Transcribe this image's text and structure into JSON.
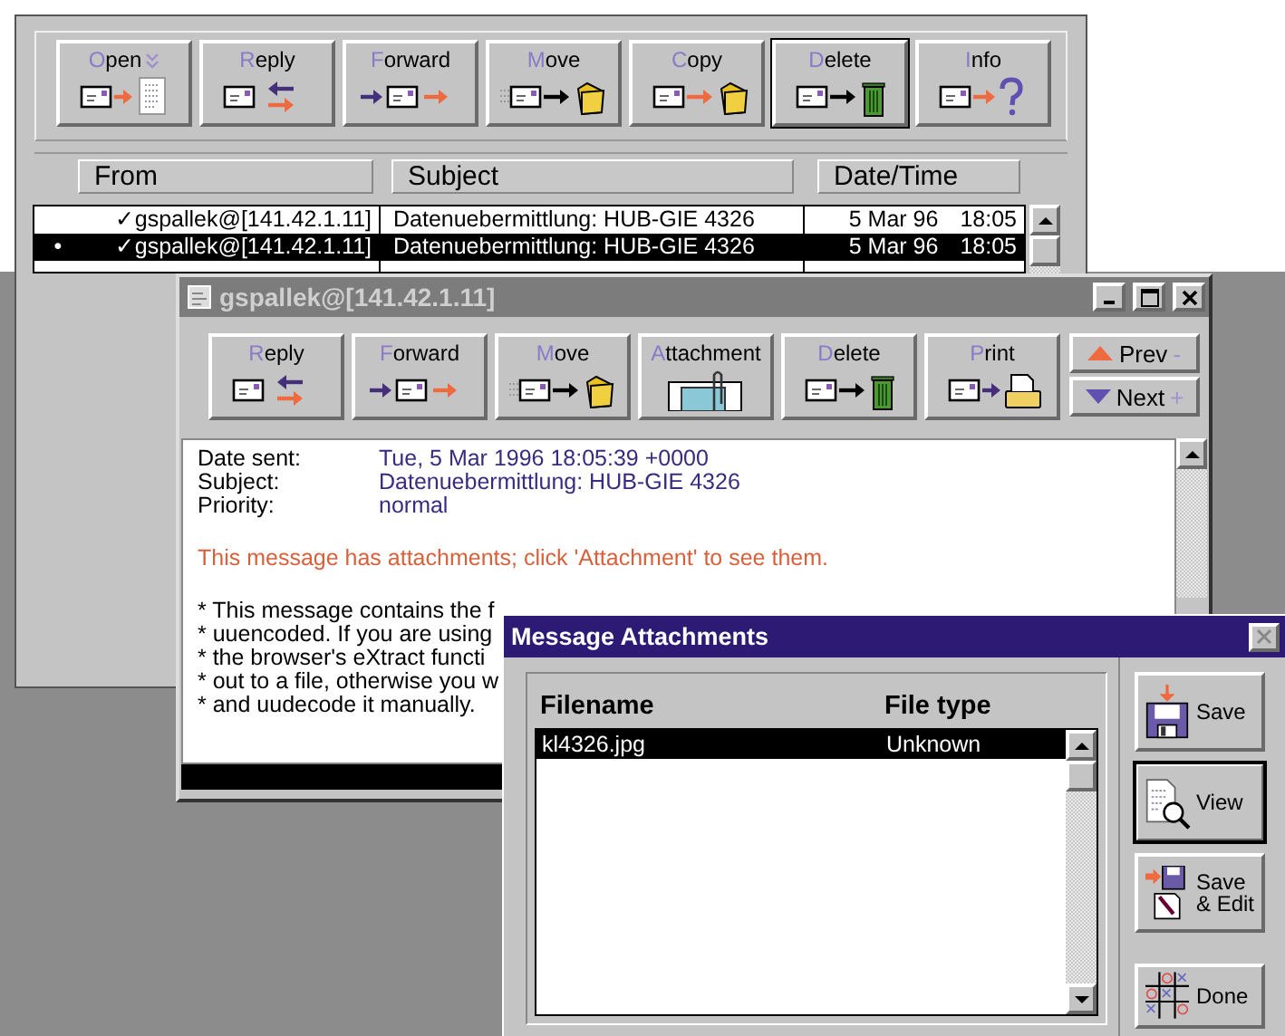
{
  "main_window": {
    "toolbar": [
      {
        "label": "Open",
        "kind": "open",
        "menu": true,
        "focused": false
      },
      {
        "label": "Reply",
        "kind": "reply",
        "menu": false,
        "focused": false
      },
      {
        "label": "Forward",
        "kind": "forward",
        "menu": false,
        "focused": false
      },
      {
        "label": "Move",
        "kind": "move",
        "menu": false,
        "focused": false
      },
      {
        "label": "Copy",
        "kind": "copy",
        "menu": false,
        "focused": false
      },
      {
        "label": "Delete",
        "kind": "delete",
        "menu": false,
        "focused": true
      },
      {
        "label": "Info",
        "kind": "info",
        "menu": false,
        "focused": false
      }
    ],
    "columns": [
      "From",
      "Subject",
      "Date/Time"
    ],
    "messages": [
      {
        "check": "✓",
        "from": "gspallek@[141.42.1.11]",
        "subject": "Datenuebermittlung: HUB-GIE 4326",
        "date": "5 Mar 96",
        "time": "18:05",
        "selected": false
      },
      {
        "marker": "•",
        "check": "✓",
        "from": "gspallek@[141.42.1.11]",
        "subject": "Datenuebermittlung: HUB-GIE 4326",
        "date": "5 Mar 96",
        "time": "18:05",
        "selected": true
      }
    ]
  },
  "message_window": {
    "title": "gspallek@[141.42.1.11]",
    "toolbar": [
      {
        "label": "Reply",
        "kind": "reply",
        "focused": false
      },
      {
        "label": "Forward",
        "kind": "forward",
        "focused": false
      },
      {
        "label": "Move",
        "kind": "move",
        "focused": false
      },
      {
        "label": "Attachment",
        "kind": "attachment",
        "focused": false
      },
      {
        "label": "Delete",
        "kind": "delete",
        "focused": false
      },
      {
        "label": "Print",
        "kind": "print",
        "focused": false
      }
    ],
    "nav": [
      {
        "label": "Prev",
        "suffix": "-",
        "kind": "prev"
      },
      {
        "label": "Next",
        "suffix": "+",
        "kind": "next"
      }
    ],
    "headers": [
      {
        "label": "Date sent:",
        "value": "Tue, 5 Mar 1996 18:05:39 +0000"
      },
      {
        "label": "Subject:",
        "value": "Datenuebermittlung: HUB-GIE 4326"
      },
      {
        "label": "Priority:",
        "value": "normal"
      }
    ],
    "notice": "This message has attachments; click 'Attachment' to see them.",
    "body_lines": [
      "* This message contains the f",
      "* uuencoded. If you are using",
      "* the browser's eXtract functi",
      "* out to a file, otherwise you w",
      "* and uudecode it manually."
    ]
  },
  "attachments_dialog": {
    "title": "Message Attachments",
    "columns": [
      "Filename",
      "File type"
    ],
    "files": [
      {
        "name": "kl4326.jpg",
        "type": "Unknown",
        "selected": true
      }
    ],
    "buttons": [
      {
        "label": "Save",
        "kind": "save",
        "focused": false
      },
      {
        "label": "View",
        "kind": "view",
        "focused": true
      },
      {
        "label": "Save\n& Edit",
        "kind": "save-edit",
        "focused": false
      },
      {
        "label": "Done",
        "kind": "done",
        "focused": false
      }
    ]
  }
}
